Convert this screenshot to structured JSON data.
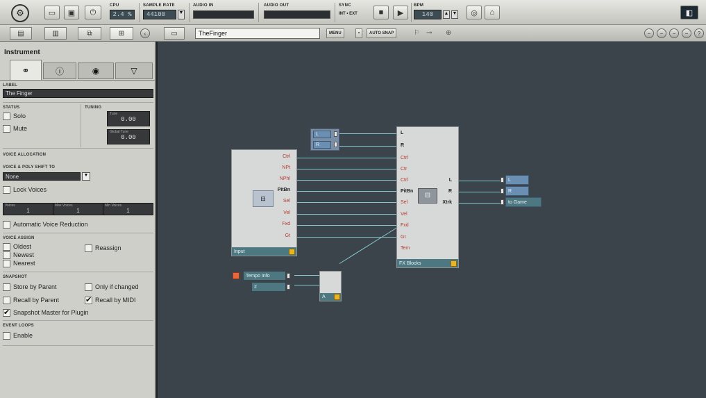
{
  "toolbar": {
    "cpu_label": "CPU",
    "cpu_value": "2.4 %",
    "samplerate_label": "Sample Rate",
    "samplerate_value": "44100",
    "audio_in_label": "Audio In",
    "audio_out_label": "Audio Out",
    "sync_label": "Sync",
    "sync_int": "INT",
    "sync_ext": "EXT",
    "bpm_label": "BPM",
    "bpm_value": "140"
  },
  "bar2": {
    "instrument_name": "TheFinger",
    "menu_label": "MENU",
    "auto_snap_label": "AUTO SNAP"
  },
  "sidebar": {
    "title": "Instrument",
    "label_title": "Label",
    "label_value": "The Finger",
    "status_title": "Status",
    "solo": "Solo",
    "mute": "Mute",
    "tuning_title": "Tuning",
    "tuning_tune_label": "Tune",
    "tuning_tune_value": "0.00",
    "tuning_global_label": "Global Tune",
    "tuning_global_value": "0.00",
    "voice_alloc_title": "Voice Allocation",
    "voice_poly_title": "Voice & Poly Shift To",
    "voice_select": "None",
    "lock_voices": "Lock Voices",
    "voices_labels": [
      "Voices",
      "Max Voices",
      "Min Voices"
    ],
    "voices_values": [
      "1",
      "1",
      "1"
    ],
    "auto_voice_reduction": "Automatic Voice Reduction",
    "voice_assign_title": "Voice Assign",
    "oldest": "Oldest",
    "newest": "Newest",
    "nearest": "Nearest",
    "reassign": "Reassign",
    "snapshot_title": "Snapshot",
    "store_by_parent": "Store by Parent",
    "only_if_changed": "Only if changed",
    "recall_by_parent": "Recall by Parent",
    "recall_by_midi": "Recall by MIDI",
    "snapshot_master": "Snapshot Master for Plugin",
    "event_loops_title": "Event Loops",
    "enable": "Enable"
  },
  "canvas": {
    "lr_in": [
      "L",
      "R"
    ],
    "input_block_name": "Input",
    "input_ports": [
      "Ctrl",
      "NPt",
      "NPhl",
      "PitBn",
      "Sel",
      "Vel",
      "Fxd",
      "Gt"
    ],
    "fx_block_name": "FX Blocks",
    "fx_in_ports": [
      "L",
      "R",
      "Ctrl",
      "Ctr",
      "Ctrl",
      "PitBn",
      "Sel",
      "Vel",
      "Fxd",
      "Gt",
      "Tem"
    ],
    "fx_out_ports": [
      "L",
      "R",
      "Xtrk"
    ],
    "out_values": [
      "L",
      "R",
      "to Game"
    ],
    "tempo_label": "Tempo Info",
    "tempo_value": "2",
    "small_block_label": "A"
  }
}
